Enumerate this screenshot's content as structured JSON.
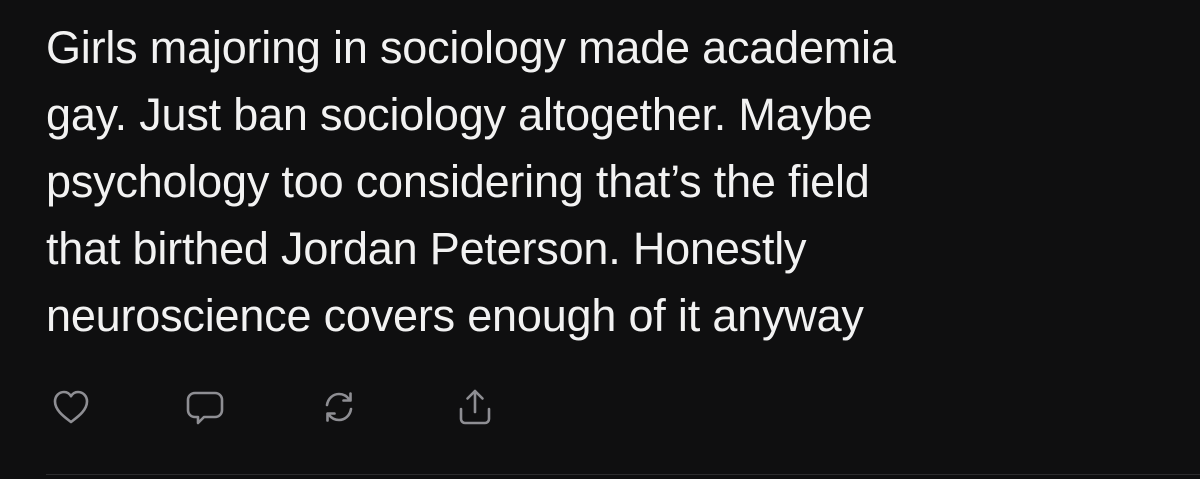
{
  "post": {
    "text_lines": [
      "Girls majoring in sociology made academia",
      "gay. Just ban sociology altogether. Maybe",
      "psychology too considering that’s the field",
      "that birthed Jordan Peterson. Honestly",
      "neuroscience covers enough of it anyway"
    ]
  },
  "actions": {
    "like": {
      "icon": "heart-icon"
    },
    "reply": {
      "icon": "speech-bubble-icon"
    },
    "repost": {
      "icon": "repost-icon"
    },
    "share": {
      "icon": "share-icon"
    }
  },
  "colors": {
    "background": "#0f0f10",
    "text": "#f2f2f2",
    "icon": "#8e8e93",
    "divider": "#2c2c2e"
  }
}
